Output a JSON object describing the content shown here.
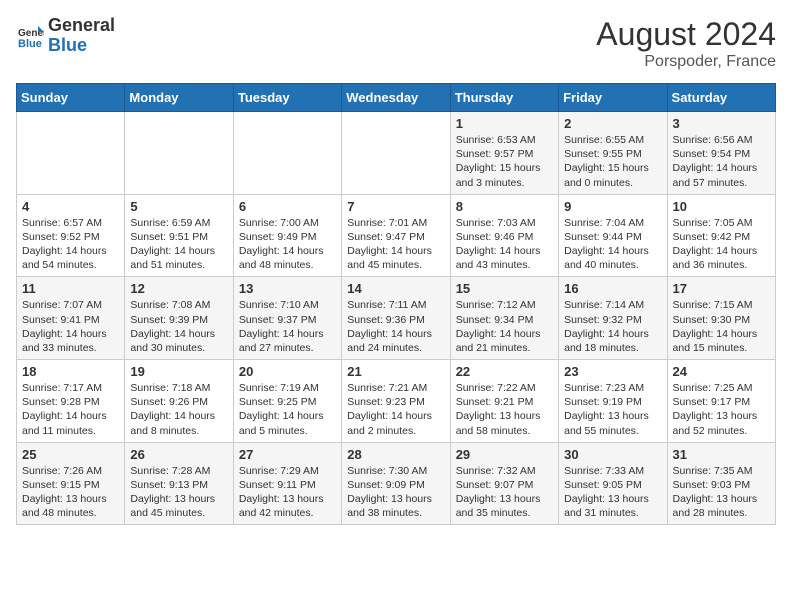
{
  "header": {
    "logo_general": "General",
    "logo_blue": "Blue",
    "month_year": "August 2024",
    "location": "Porspoder, France"
  },
  "weekdays": [
    "Sunday",
    "Monday",
    "Tuesday",
    "Wednesday",
    "Thursday",
    "Friday",
    "Saturday"
  ],
  "weeks": [
    [
      {
        "day": "",
        "info": ""
      },
      {
        "day": "",
        "info": ""
      },
      {
        "day": "",
        "info": ""
      },
      {
        "day": "",
        "info": ""
      },
      {
        "day": "1",
        "info": "Sunrise: 6:53 AM\nSunset: 9:57 PM\nDaylight: 15 hours\nand 3 minutes."
      },
      {
        "day": "2",
        "info": "Sunrise: 6:55 AM\nSunset: 9:55 PM\nDaylight: 15 hours\nand 0 minutes."
      },
      {
        "day": "3",
        "info": "Sunrise: 6:56 AM\nSunset: 9:54 PM\nDaylight: 14 hours\nand 57 minutes."
      }
    ],
    [
      {
        "day": "4",
        "info": "Sunrise: 6:57 AM\nSunset: 9:52 PM\nDaylight: 14 hours\nand 54 minutes."
      },
      {
        "day": "5",
        "info": "Sunrise: 6:59 AM\nSunset: 9:51 PM\nDaylight: 14 hours\nand 51 minutes."
      },
      {
        "day": "6",
        "info": "Sunrise: 7:00 AM\nSunset: 9:49 PM\nDaylight: 14 hours\nand 48 minutes."
      },
      {
        "day": "7",
        "info": "Sunrise: 7:01 AM\nSunset: 9:47 PM\nDaylight: 14 hours\nand 45 minutes."
      },
      {
        "day": "8",
        "info": "Sunrise: 7:03 AM\nSunset: 9:46 PM\nDaylight: 14 hours\nand 43 minutes."
      },
      {
        "day": "9",
        "info": "Sunrise: 7:04 AM\nSunset: 9:44 PM\nDaylight: 14 hours\nand 40 minutes."
      },
      {
        "day": "10",
        "info": "Sunrise: 7:05 AM\nSunset: 9:42 PM\nDaylight: 14 hours\nand 36 minutes."
      }
    ],
    [
      {
        "day": "11",
        "info": "Sunrise: 7:07 AM\nSunset: 9:41 PM\nDaylight: 14 hours\nand 33 minutes."
      },
      {
        "day": "12",
        "info": "Sunrise: 7:08 AM\nSunset: 9:39 PM\nDaylight: 14 hours\nand 30 minutes."
      },
      {
        "day": "13",
        "info": "Sunrise: 7:10 AM\nSunset: 9:37 PM\nDaylight: 14 hours\nand 27 minutes."
      },
      {
        "day": "14",
        "info": "Sunrise: 7:11 AM\nSunset: 9:36 PM\nDaylight: 14 hours\nand 24 minutes."
      },
      {
        "day": "15",
        "info": "Sunrise: 7:12 AM\nSunset: 9:34 PM\nDaylight: 14 hours\nand 21 minutes."
      },
      {
        "day": "16",
        "info": "Sunrise: 7:14 AM\nSunset: 9:32 PM\nDaylight: 14 hours\nand 18 minutes."
      },
      {
        "day": "17",
        "info": "Sunrise: 7:15 AM\nSunset: 9:30 PM\nDaylight: 14 hours\nand 15 minutes."
      }
    ],
    [
      {
        "day": "18",
        "info": "Sunrise: 7:17 AM\nSunset: 9:28 PM\nDaylight: 14 hours\nand 11 minutes."
      },
      {
        "day": "19",
        "info": "Sunrise: 7:18 AM\nSunset: 9:26 PM\nDaylight: 14 hours\nand 8 minutes."
      },
      {
        "day": "20",
        "info": "Sunrise: 7:19 AM\nSunset: 9:25 PM\nDaylight: 14 hours\nand 5 minutes."
      },
      {
        "day": "21",
        "info": "Sunrise: 7:21 AM\nSunset: 9:23 PM\nDaylight: 14 hours\nand 2 minutes."
      },
      {
        "day": "22",
        "info": "Sunrise: 7:22 AM\nSunset: 9:21 PM\nDaylight: 13 hours\nand 58 minutes."
      },
      {
        "day": "23",
        "info": "Sunrise: 7:23 AM\nSunset: 9:19 PM\nDaylight: 13 hours\nand 55 minutes."
      },
      {
        "day": "24",
        "info": "Sunrise: 7:25 AM\nSunset: 9:17 PM\nDaylight: 13 hours\nand 52 minutes."
      }
    ],
    [
      {
        "day": "25",
        "info": "Sunrise: 7:26 AM\nSunset: 9:15 PM\nDaylight: 13 hours\nand 48 minutes."
      },
      {
        "day": "26",
        "info": "Sunrise: 7:28 AM\nSunset: 9:13 PM\nDaylight: 13 hours\nand 45 minutes."
      },
      {
        "day": "27",
        "info": "Sunrise: 7:29 AM\nSunset: 9:11 PM\nDaylight: 13 hours\nand 42 minutes."
      },
      {
        "day": "28",
        "info": "Sunrise: 7:30 AM\nSunset: 9:09 PM\nDaylight: 13 hours\nand 38 minutes."
      },
      {
        "day": "29",
        "info": "Sunrise: 7:32 AM\nSunset: 9:07 PM\nDaylight: 13 hours\nand 35 minutes."
      },
      {
        "day": "30",
        "info": "Sunrise: 7:33 AM\nSunset: 9:05 PM\nDaylight: 13 hours\nand 31 minutes."
      },
      {
        "day": "31",
        "info": "Sunrise: 7:35 AM\nSunset: 9:03 PM\nDaylight: 13 hours\nand 28 minutes."
      }
    ]
  ]
}
